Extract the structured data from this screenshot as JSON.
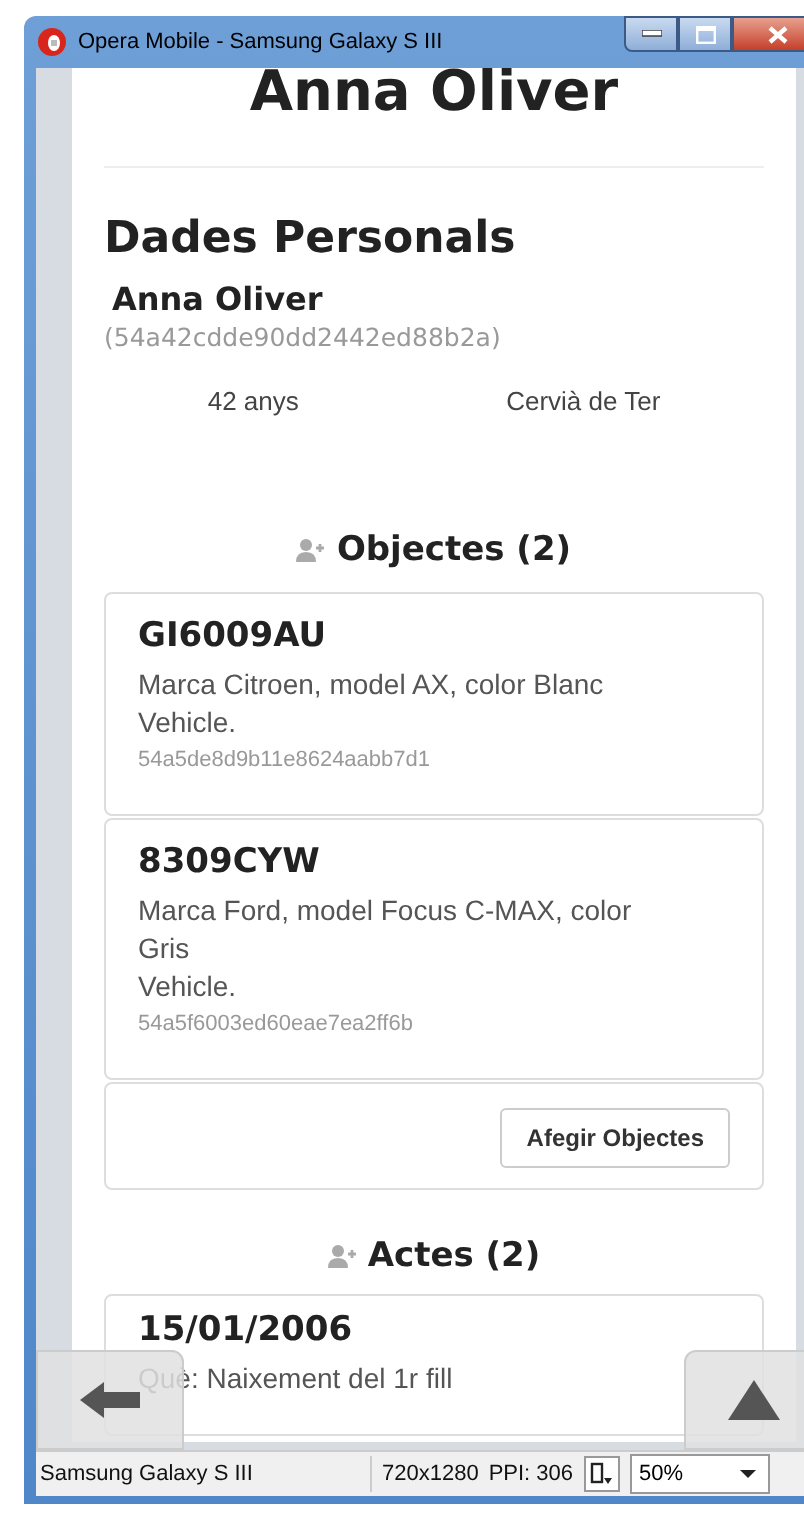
{
  "window": {
    "title": "Opera Mobile - Samsung Galaxy S III"
  },
  "page": {
    "heading": "Anna Oliver",
    "section_title": "Dades Personals",
    "person": {
      "name": "Anna Oliver",
      "id": "(54a42cdde90dd2442ed88b2a)",
      "age": "42 anys",
      "place": "Cervià de Ter"
    },
    "objects": {
      "title": "Objectes (2)",
      "items": [
        {
          "title": "GI6009AU",
          "description": "Marca Citroen, model AX, color Blanc",
          "type": "Vehicle.",
          "id": "54a5de8d9b11e8624aabb7d1"
        },
        {
          "title": "8309CYW",
          "description": "Marca Ford, model Focus C-MAX, color Gris",
          "type": "Vehicle.",
          "id": "54a5f6003ed60eae7ea2ff6b"
        }
      ],
      "button": "Afegir Objectes"
    },
    "acts": {
      "title": "Actes (2)",
      "items": [
        {
          "title": "15/01/2006",
          "description": "Què: Naixement del 1r fill"
        }
      ]
    }
  },
  "status_bar": {
    "device": "Samsung Galaxy S III",
    "resolution": "720x1280",
    "ppi": "PPI: 306",
    "zoom": "50%"
  }
}
